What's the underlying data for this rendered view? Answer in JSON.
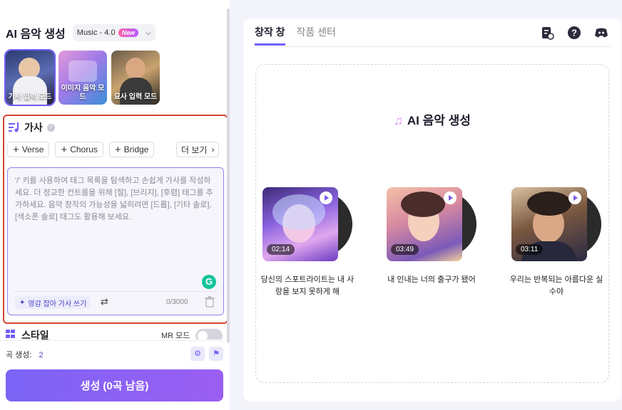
{
  "header": {
    "title": "AI 음악 생성",
    "model": "Music - 4.0",
    "model_badge": "New"
  },
  "modes": [
    {
      "label": "가사 입력 모드",
      "active": true
    },
    {
      "label": "이미지 음악 모드",
      "active": false
    },
    {
      "label": "묘사 입력 모드",
      "active": false
    }
  ],
  "lyrics": {
    "title": "가사",
    "tags": [
      "Verse",
      "Chorus",
      "Bridge"
    ],
    "more": "더 보기",
    "placeholder": "'/' 키를 사용하여 태그 목록을 탐색하고 손쉽게 가사를 작성하세요. 더 정교한 컨트롤을 위해 [절], [브리지], [후렴] 태그를 추가하세요. 음악 창작의 가능성을 넓히려면 [드롭], [기타 솔로], [색소폰 솔로] 태그도 활용해 보세요.",
    "inspire": "영감 잡아 가사 쓰기",
    "counter": "0/3000"
  },
  "style": {
    "title": "스타일",
    "mr_label": "MR 모드"
  },
  "footer": {
    "count_label": "곡 생성:",
    "count_value": "2",
    "generate": "생성 (0곡 남음)"
  },
  "right": {
    "tabs": [
      "창작 창",
      "작품 센터"
    ],
    "gallery_title": "AI 음악 생성",
    "songs": [
      {
        "duration": "02:14",
        "caption": "당신의 스포트라이트는 내 사랑을 보지 못하게 해"
      },
      {
        "duration": "03:49",
        "caption": "내 인내는 너의 출구가 됐어"
      },
      {
        "duration": "03:11",
        "caption": "우리는 반복되는 아름다운 실수야"
      }
    ]
  },
  "icons": [
    "music-note-icon",
    "help-icon",
    "plus-icon",
    "chevron-right-icon",
    "grammarly-icon",
    "sparkle-icon",
    "shuffle-icon",
    "trash-icon",
    "settings-icon",
    "lock-icon",
    "history-icon",
    "question-icon",
    "discord-icon",
    "play-icon"
  ]
}
